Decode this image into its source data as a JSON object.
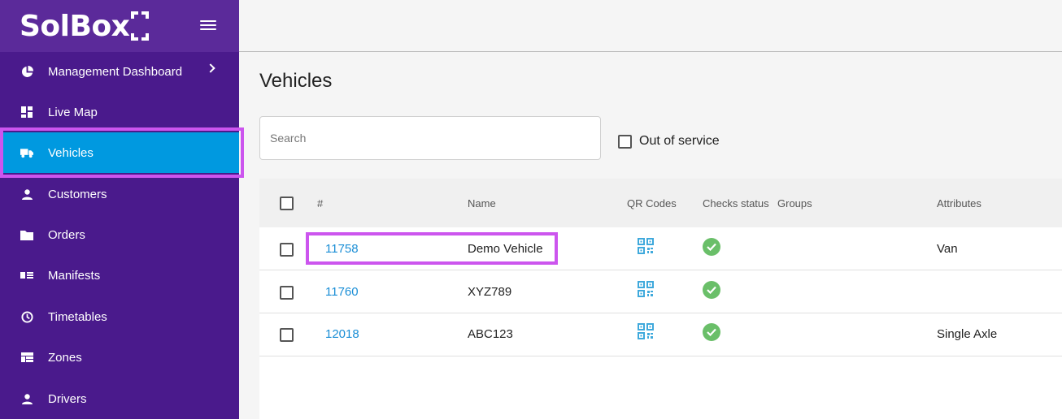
{
  "brand": {
    "name": "SolBox"
  },
  "sidebar": {
    "items": [
      {
        "label": "Management Dashboard",
        "icon": "pie-chart-icon",
        "has_chevron": true
      },
      {
        "label": "Live Map",
        "icon": "dashboard-grid-icon"
      },
      {
        "label": "Vehicles",
        "icon": "truck-icon",
        "active": true
      },
      {
        "label": "Customers",
        "icon": "person-icon"
      },
      {
        "label": "Orders",
        "icon": "folder-icon"
      },
      {
        "label": "Manifests",
        "icon": "list-card-icon"
      },
      {
        "label": "Timetables",
        "icon": "clock-icon"
      },
      {
        "label": "Zones",
        "icon": "grid-table-icon"
      },
      {
        "label": "Drivers",
        "icon": "person-icon"
      }
    ]
  },
  "page": {
    "title": "Vehicles",
    "search_placeholder": "Search",
    "out_of_service_label": "Out of service"
  },
  "table": {
    "columns": [
      "#",
      "Name",
      "QR Codes",
      "Checks status",
      "Groups",
      "Attributes"
    ],
    "rows": [
      {
        "id": "11758",
        "name": "Demo Vehicle",
        "checks": "ok",
        "groups": "",
        "attributes": "Van"
      },
      {
        "id": "11760",
        "name": "XYZ789",
        "checks": "ok",
        "groups": "",
        "attributes": ""
      },
      {
        "id": "12018",
        "name": "ABC123",
        "checks": "ok",
        "groups": "",
        "attributes": "Single Axle"
      }
    ]
  },
  "colors": {
    "sidebar_bg": "#4a1a8c",
    "active_item": "#0099e0",
    "highlight": "#cc55ee",
    "link": "#1a8ed6",
    "check_ok": "#6abf69",
    "qr_icon": "#3fa9dc"
  }
}
